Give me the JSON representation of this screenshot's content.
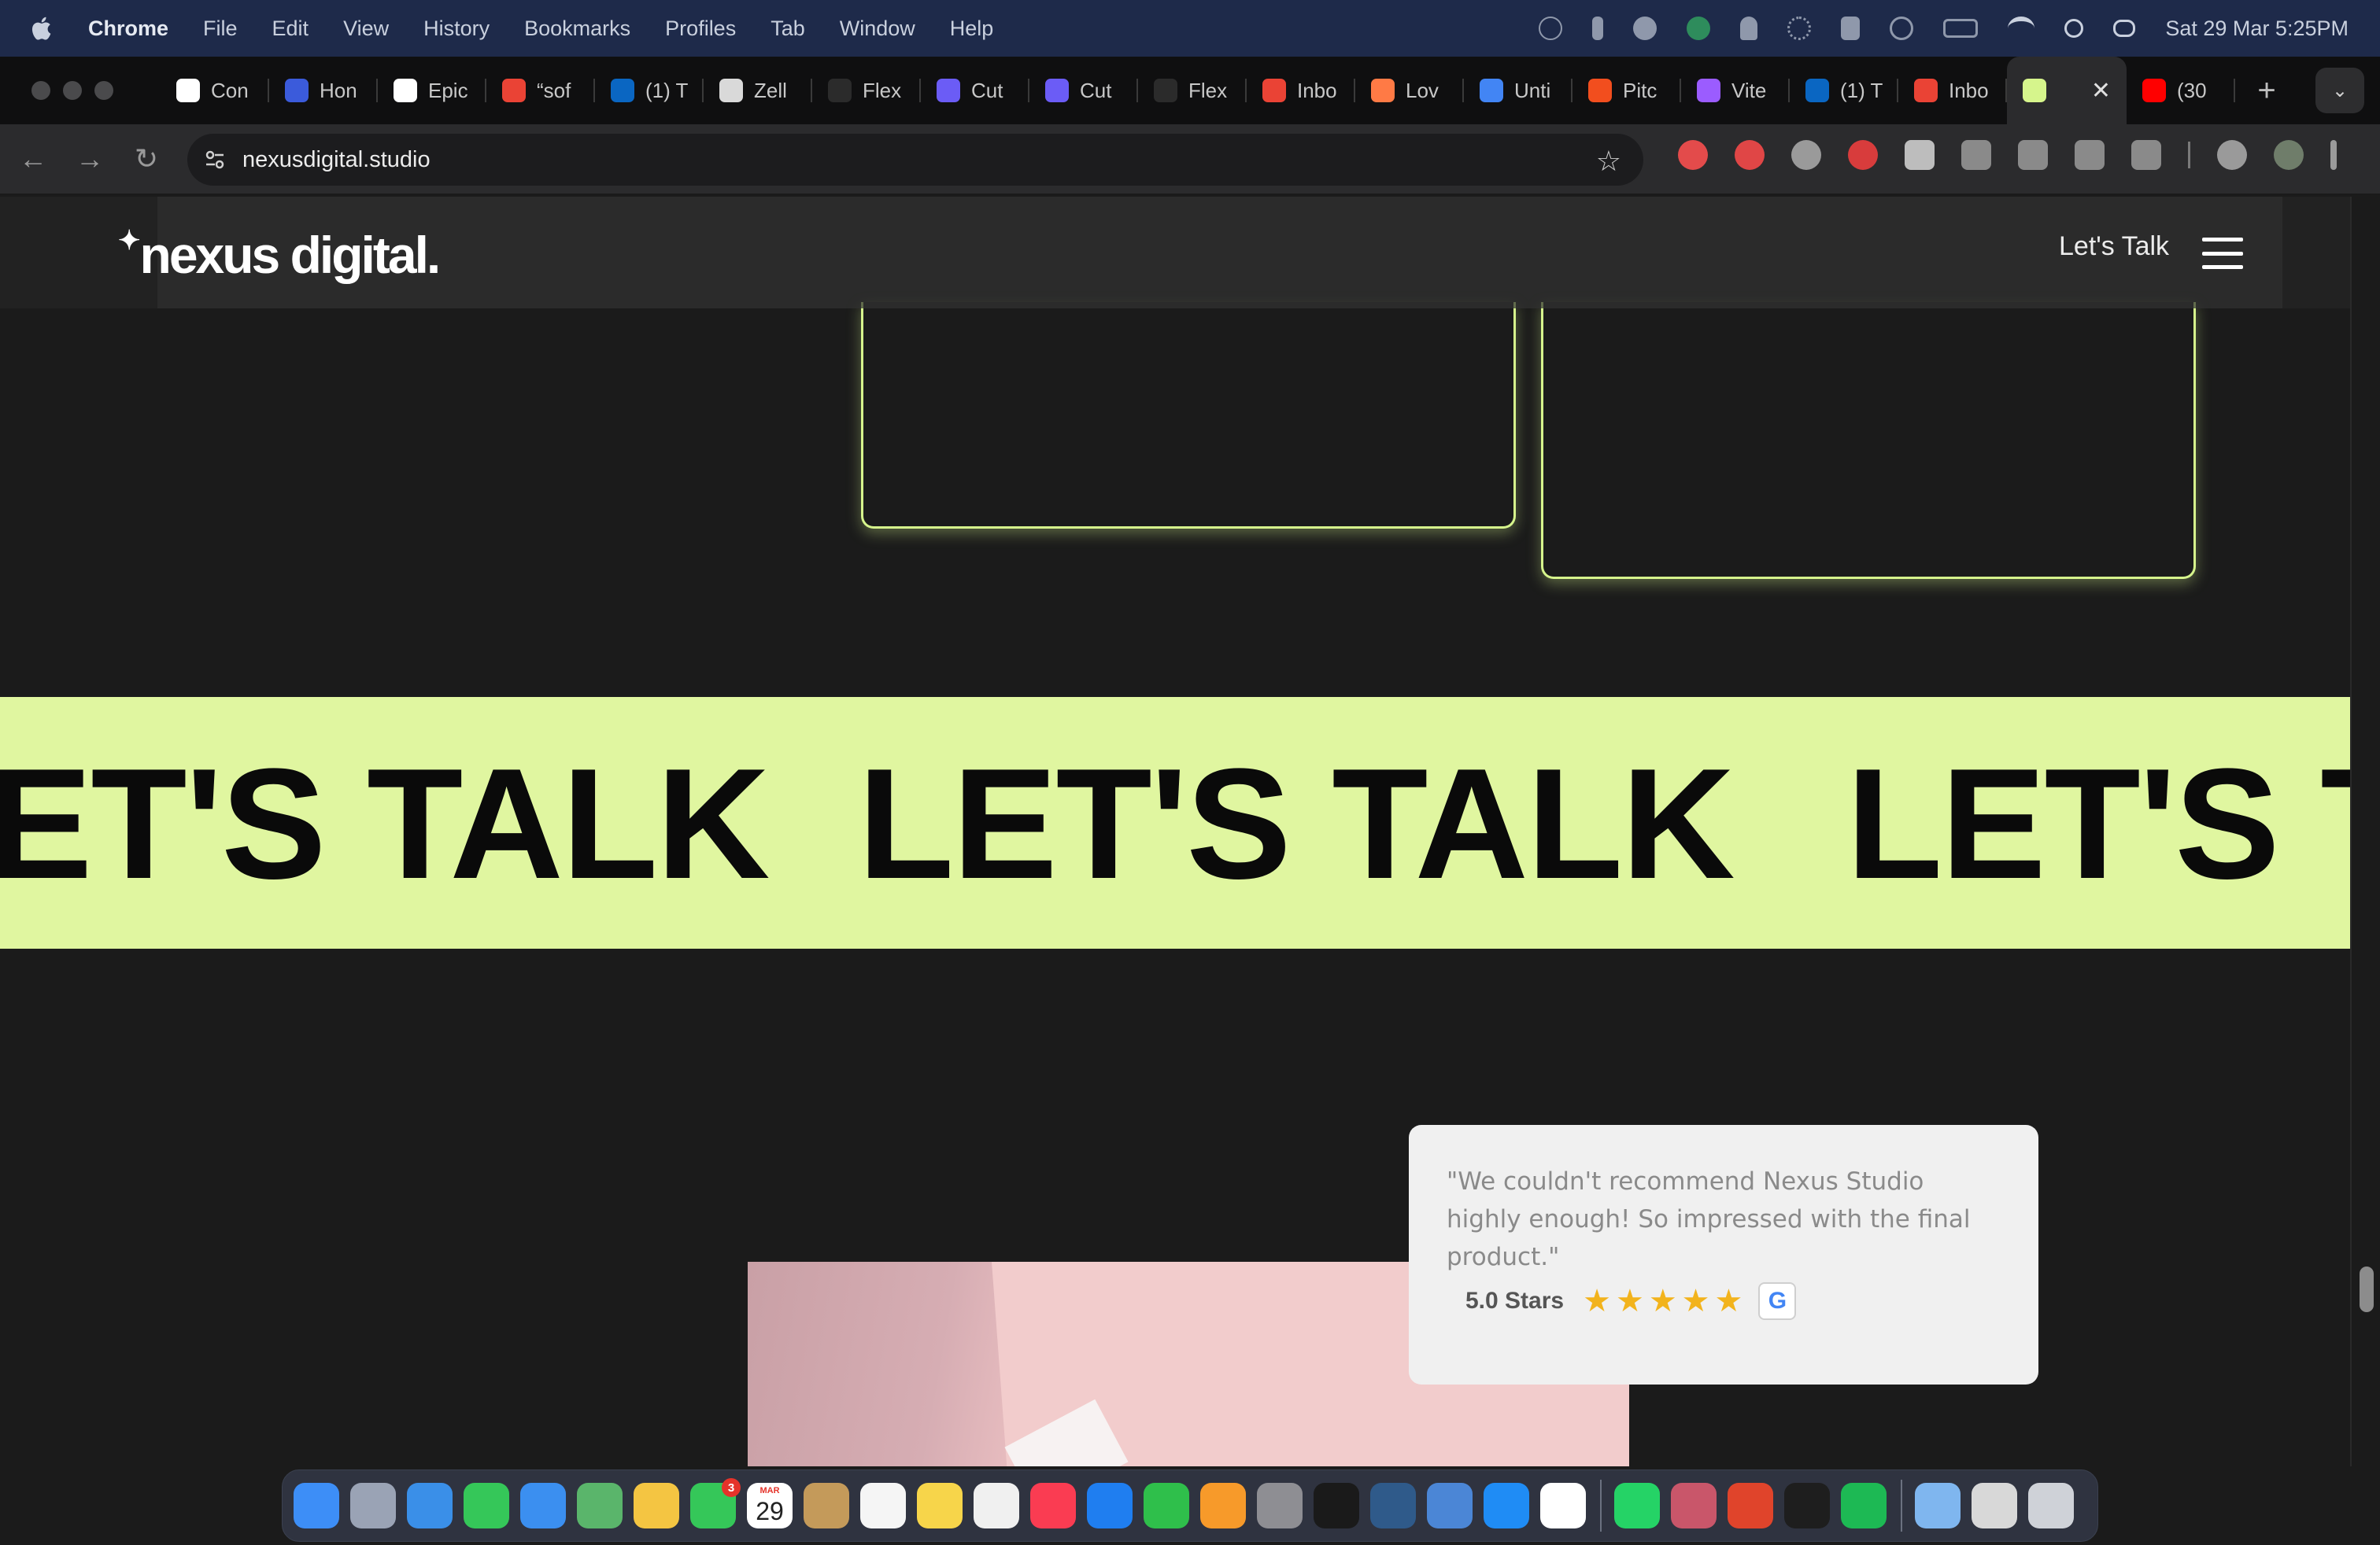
{
  "menubar": {
    "app_name": "Chrome",
    "items": [
      "File",
      "Edit",
      "View",
      "History",
      "Bookmarks",
      "Profiles",
      "Tab",
      "Window",
      "Help"
    ],
    "clock": "Sat 29 Mar  5:25PM"
  },
  "tabs": [
    {
      "label": "Con",
      "icon": "openai-icon",
      "color": "#ffffff"
    },
    {
      "label": "Hon",
      "icon": "kraken-icon",
      "color": "#3b5bdb"
    },
    {
      "label": "Epic",
      "icon": "grid-icon",
      "color": "#ffffff"
    },
    {
      "label": "“sof",
      "icon": "gmail-icon",
      "color": "#ea4335"
    },
    {
      "label": "(1) T",
      "icon": "linkedin-icon",
      "color": "#0a66c2"
    },
    {
      "label": "Zell",
      "icon": "zellij-icon",
      "color": "#d9d9d9"
    },
    {
      "label": "Flex",
      "icon": "flex-icon",
      "color": "#2b2b2b"
    },
    {
      "label": "Cut",
      "icon": "cut-icon",
      "color": "#6b5cf6"
    },
    {
      "label": "Cut",
      "icon": "cut-icon",
      "color": "#6b5cf6"
    },
    {
      "label": "Flex",
      "icon": "flex-icon",
      "color": "#2b2b2b"
    },
    {
      "label": "Inbo",
      "icon": "gmail-icon",
      "color": "#ea4335"
    },
    {
      "label": "Lov",
      "icon": "heart-icon",
      "color": "#ff7a45"
    },
    {
      "label": "Unti",
      "icon": "docs-icon",
      "color": "#4285f4"
    },
    {
      "label": "Pitc",
      "icon": "figma-icon",
      "color": "#f24e1e"
    },
    {
      "label": "Vite",
      "icon": "vite-icon",
      "color": "#9b5cff"
    },
    {
      "label": "(1) T",
      "icon": "linkedin-icon",
      "color": "#0a66c2"
    },
    {
      "label": "Inbo",
      "icon": "gmail-icon",
      "color": "#ea4335"
    }
  ],
  "active_tab": {
    "label": "",
    "icon": "nexus-icon",
    "color": "#d6f58c",
    "close": "✕"
  },
  "last_tab": {
    "label": "(30",
    "icon": "youtube-icon",
    "color": "#ff0000"
  },
  "toolbar": {
    "url": "nexusdigital.studio",
    "back": "←",
    "forward": "→",
    "reload": "↻",
    "star": "☆",
    "extensions": [
      {
        "name": "pokeball-extension-icon",
        "color": "#e34b4b"
      },
      {
        "name": "hand-extension-icon",
        "color": "#e04646"
      },
      {
        "name": "mask-extension-icon",
        "color": "#9a9a9a"
      },
      {
        "name": "abp-extension-icon",
        "color": "#d83c3c"
      },
      {
        "name": "eyedropper-extension-icon",
        "color": "#bdbdbd"
      },
      {
        "name": "shield-extension-icon",
        "color": "#8a8a8a"
      },
      {
        "name": "compass-extension-icon",
        "color": "#8a8a8a"
      },
      {
        "name": "function-extension-icon",
        "color": "#8a8a8a"
      },
      {
        "name": "puzzle-extension-icon",
        "color": "#8a8a8a"
      }
    ]
  },
  "page": {
    "logo": "nexus digital.",
    "nav_link": "Let's Talk",
    "marquee_text": "LET'S TALK",
    "marquee_fragment_left": "ET'S TALK",
    "marquee_fragment_right": "LET'S TA",
    "accent_color": "#e0f6a0",
    "review": {
      "quote": "\"We couldn't recommend Nexus Studio highly enough! So impressed with the final product.\"",
      "rating_label": "5.0 Stars",
      "stars": 5,
      "source_icon": "G"
    }
  },
  "dock": {
    "calendar_month": "MAR",
    "calendar_day": "29",
    "facetime_badge": "3",
    "apps": [
      {
        "name": "finder",
        "color": "#3d8ef7"
      },
      {
        "name": "launchpad",
        "color": "#9aa3b5"
      },
      {
        "name": "safari",
        "color": "#3a8fe8"
      },
      {
        "name": "messages",
        "color": "#35c759"
      },
      {
        "name": "mail",
        "color": "#3b8ff0"
      },
      {
        "name": "maps",
        "color": "#5ab56b"
      },
      {
        "name": "photos",
        "color": "#f4c542"
      },
      {
        "name": "facetime",
        "color": "#35c759"
      },
      {
        "name": "calendar",
        "color": "#ffffff"
      },
      {
        "name": "contacts",
        "color": "#c49a5a"
      },
      {
        "name": "reminders",
        "color": "#f5f5f5"
      },
      {
        "name": "notes",
        "color": "#f7d54a"
      },
      {
        "name": "freeform",
        "color": "#f0f0f0"
      },
      {
        "name": "music",
        "color": "#fa3c52"
      },
      {
        "name": "keynote",
        "color": "#1f7ef0"
      },
      {
        "name": "numbers",
        "color": "#2fbf4b"
      },
      {
        "name": "pages",
        "color": "#f79a2a"
      },
      {
        "name": "system-settings",
        "color": "#8e8e93"
      },
      {
        "name": "terminal",
        "color": "#1a1a1a"
      },
      {
        "name": "mysql-workbench",
        "color": "#2f5a8a"
      },
      {
        "name": "xcode-instruments",
        "color": "#4b86d6"
      },
      {
        "name": "app-store",
        "color": "#1f8cf5"
      },
      {
        "name": "chrome",
        "color": "#ffffff"
      },
      {
        "name": "whatsapp",
        "color": "#25d366"
      },
      {
        "name": "affinity",
        "color": "#c9566a"
      },
      {
        "name": "pdf-expert",
        "color": "#e0442b"
      },
      {
        "name": "figma",
        "color": "#1e1e1e"
      },
      {
        "name": "spotify",
        "color": "#1db954"
      }
    ],
    "trailing": [
      {
        "name": "downloads-folder",
        "color": "#7fb6ef"
      },
      {
        "name": "screenshot-stack",
        "color": "#d8d8d8"
      },
      {
        "name": "trash",
        "color": "#cfd2d8"
      }
    ]
  }
}
